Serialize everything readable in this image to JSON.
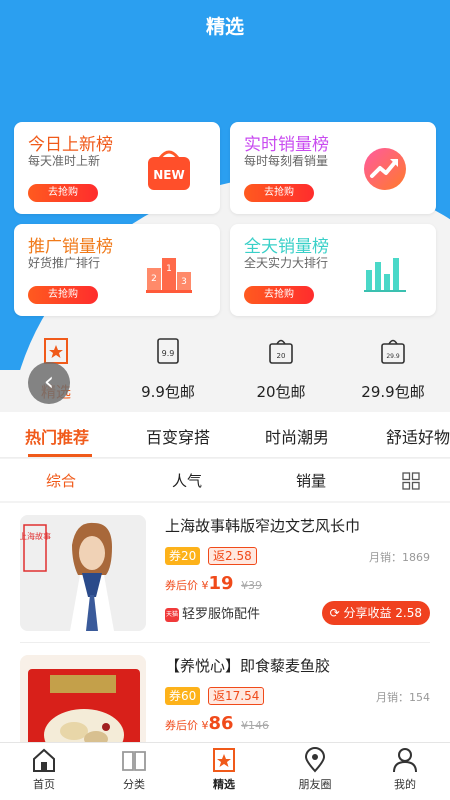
{
  "header": {
    "title": "精选"
  },
  "cards": [
    {
      "title": "今日上新榜",
      "subtitle": "每天准时上新",
      "button": "去抢购",
      "title_color": "#f05a1a",
      "icon": "shopping-bag-icon",
      "icon_text": "NEW"
    },
    {
      "title": "实时销量榜",
      "subtitle": "每时每刻看销量",
      "button": "去抢购",
      "title_color": "#c94cf0",
      "icon": "trending-up-icon"
    },
    {
      "title": "推广销量榜",
      "subtitle": "好货推广排行",
      "button": "去抢购",
      "title_color": "#f07a1a",
      "icon": "podium-icon",
      "podium": [
        "2",
        "1",
        "3"
      ]
    },
    {
      "title": "全天销量榜",
      "subtitle": "全天实力大排行",
      "button": "去抢购",
      "title_color": "#3ad0c8",
      "icon": "bar-chart-icon"
    }
  ],
  "categories": [
    {
      "label": "精选",
      "icon": "star-frame-icon"
    },
    {
      "label": "9.9包邮",
      "icon": "tag-icon",
      "icon_text": "9.9"
    },
    {
      "label": "20包邮",
      "icon": "bag-icon",
      "icon_text": "20"
    },
    {
      "label": "29.9包邮",
      "icon": "bag-icon",
      "icon_text": "29.9"
    }
  ],
  "back_button": "‹",
  "tabs": [
    "热门推荐",
    "百变穿搭",
    "时尚潮男",
    "舒适好物"
  ],
  "sort": [
    "综合",
    "人气",
    "销量"
  ],
  "products": [
    {
      "title": "上海故事韩版窄边文艺风长巾",
      "coupon": "券20",
      "rebate": "返2.58",
      "sales": "月销：1869",
      "price_label": "券后价",
      "currency": "¥",
      "price": "19",
      "old_price": "¥39",
      "shop_badge": "天猫",
      "shop": "轻罗服饰配件",
      "share": "分享收益 2.58",
      "thumb_brand": "上海故事"
    },
    {
      "title": "【养悦心】即食藜麦鱼胶",
      "coupon": "券60",
      "rebate": "返17.54",
      "sales": "月销：154",
      "price_label": "券后价",
      "currency": "¥",
      "price": "86",
      "old_price": "¥146"
    }
  ],
  "nav": [
    {
      "label": "首页",
      "icon": "home-icon"
    },
    {
      "label": "分类",
      "icon": "book-icon"
    },
    {
      "label": "精选",
      "icon": "star-frame-icon"
    },
    {
      "label": "朋友圈",
      "icon": "location-pin-icon"
    },
    {
      "label": "我的",
      "icon": "user-icon"
    }
  ]
}
